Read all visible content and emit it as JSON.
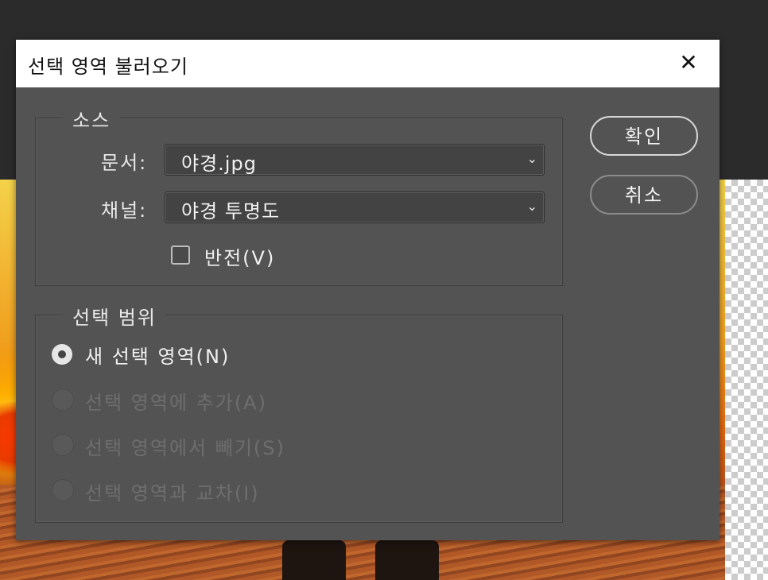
{
  "dialog": {
    "title": "선택 영역 불러오기",
    "close_glyph": "✕"
  },
  "source": {
    "legend": "소스",
    "document_label": "문서:",
    "document_value": "야경.jpg",
    "channel_label": "채널:",
    "channel_value": "야경 투명도",
    "invert_label": "반전(V)",
    "invert_checked": false,
    "dropdown_glyph": "⌄"
  },
  "operation": {
    "legend": "선택 범위",
    "options": [
      {
        "label": "새 선택 영역(N)",
        "selected": true,
        "enabled": true
      },
      {
        "label": "선택 영역에 추가(A)",
        "selected": false,
        "enabled": false
      },
      {
        "label": "선택 영역에서 빼기(S)",
        "selected": false,
        "enabled": false
      },
      {
        "label": "선택 영역과 교차(I)",
        "selected": false,
        "enabled": false
      }
    ]
  },
  "buttons": {
    "ok": "확인",
    "cancel": "취소"
  }
}
